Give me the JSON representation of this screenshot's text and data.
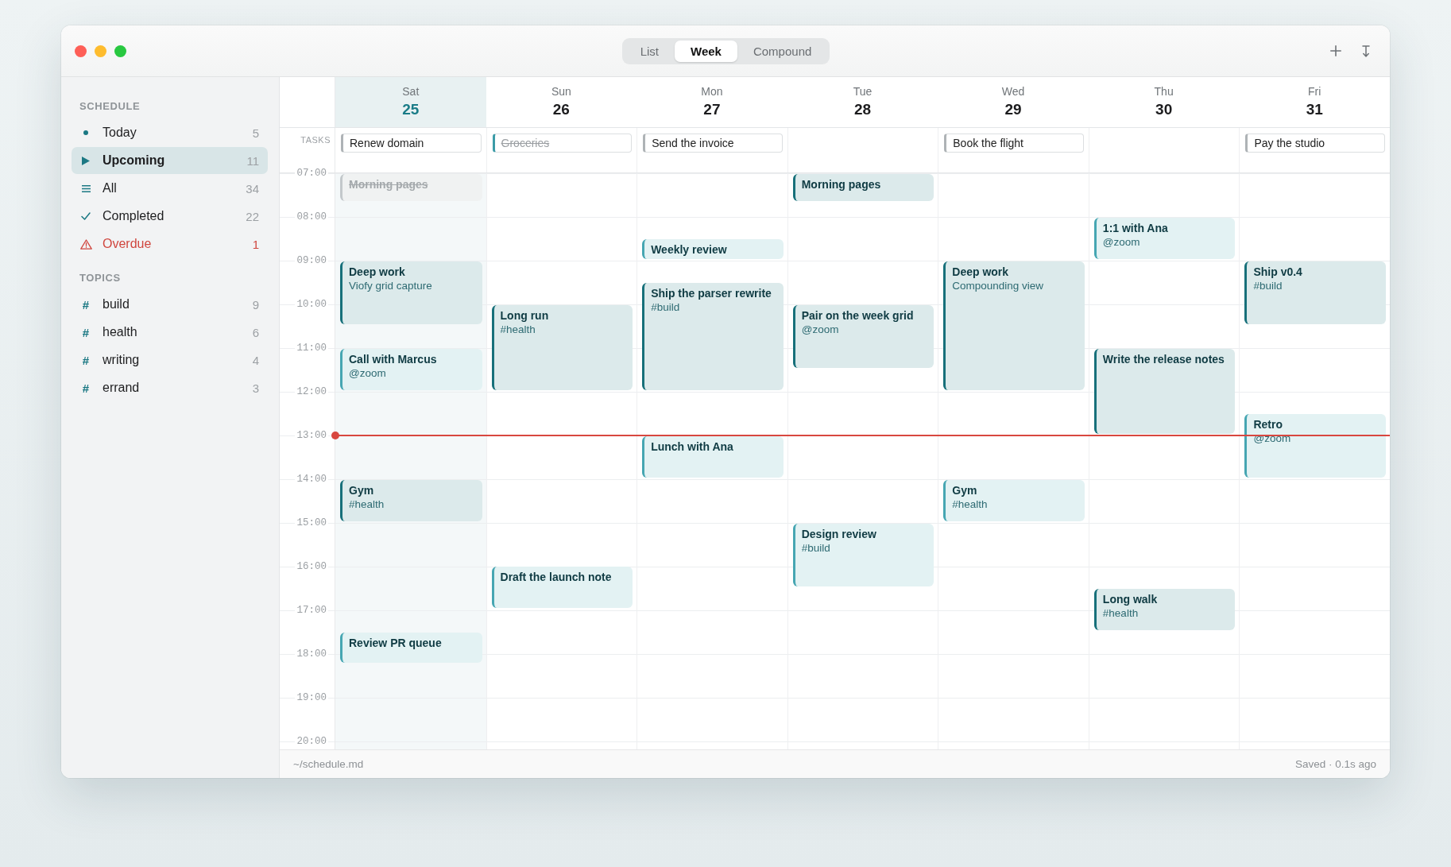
{
  "toolbar": {
    "tabs": [
      {
        "label": "List",
        "selected": false
      },
      {
        "label": "Week",
        "selected": true
      },
      {
        "label": "Compound",
        "selected": false
      }
    ]
  },
  "sidebar": {
    "sections": [
      {
        "heading": "SCHEDULE",
        "items": [
          {
            "kind": "today",
            "label": "Today",
            "count": "5",
            "selected": false
          },
          {
            "kind": "upcoming",
            "label": "Upcoming",
            "count": "11",
            "selected": true
          },
          {
            "kind": "all",
            "label": "All",
            "count": "34",
            "selected": false
          },
          {
            "kind": "completed",
            "label": "Completed",
            "count": "22",
            "selected": false
          },
          {
            "kind": "overdue",
            "label": "Overdue",
            "count": "1",
            "selected": false
          }
        ]
      },
      {
        "heading": "TOPICS",
        "items": [
          {
            "kind": "topic",
            "symbol": "#",
            "label": "build",
            "count": "9",
            "selected": false
          },
          {
            "kind": "topic",
            "symbol": "#",
            "label": "health",
            "count": "6",
            "selected": false
          },
          {
            "kind": "topic",
            "symbol": "#",
            "label": "writing",
            "count": "4",
            "selected": false
          },
          {
            "kind": "topic",
            "symbol": "#",
            "label": "errand",
            "count": "3",
            "selected": false
          }
        ]
      }
    ]
  },
  "calendar": {
    "tasks_label": "TASKS",
    "hours": [
      "07:00",
      "08:00",
      "09:00",
      "10:00",
      "11:00",
      "12:00",
      "13:00",
      "14:00",
      "15:00",
      "16:00",
      "17:00",
      "18:00",
      "19:00",
      "20:00"
    ],
    "days": [
      {
        "name": "Sat",
        "number": "25",
        "today": true,
        "tasks": [
          {
            "title": "Renew domain",
            "done": false
          }
        ],
        "events": [
          {
            "title": "Morning pages",
            "done": true,
            "color": "#c3c8cb"
          },
          {
            "title": "Deep work",
            "note": "Viofy grid capture",
            "done": false,
            "color": "#17707a"
          },
          {
            "title": "Call with Marcus",
            "note": "@zoom",
            "done": false,
            "color": "#46a6b2"
          },
          {
            "title": "Gym",
            "note": "#health",
            "done": false,
            "color": "#17707a"
          },
          {
            "title": "Review PR queue",
            "done": false,
            "color": "#46a6b2"
          }
        ]
      },
      {
        "name": "Sun",
        "number": "26",
        "today": false,
        "tasks": [
          {
            "title": "Groceries",
            "done": true
          }
        ],
        "events": [
          {
            "title": "Long run",
            "note": "#health",
            "done": false,
            "color": "#17707a"
          },
          {
            "title": "Draft the launch note",
            "done": false,
            "color": "#46a6b2"
          }
        ]
      },
      {
        "name": "Mon",
        "number": "27",
        "today": false,
        "tasks": [
          {
            "title": "Send the invoice",
            "done": false
          }
        ],
        "events": [
          {
            "title": "Weekly review",
            "done": false,
            "color": "#46a6b2"
          },
          {
            "title": "Ship the parser rewrite",
            "note": "#build",
            "done": false,
            "color": "#17707a"
          },
          {
            "title": "Lunch with Ana",
            "done": false,
            "color": "#46a6b2"
          }
        ]
      },
      {
        "name": "Tue",
        "number": "28",
        "today": false,
        "events": [
          {
            "title": "Morning pages",
            "done": false,
            "color": "#17707a"
          },
          {
            "title": "Pair on the week grid",
            "note": "@zoom",
            "done": false,
            "color": "#17707a"
          },
          {
            "title": "Design review",
            "note": "#build",
            "done": false,
            "color": "#46a6b2"
          }
        ]
      },
      {
        "name": "Wed",
        "number": "29",
        "today": false,
        "tasks": [
          {
            "title": "Book the flight",
            "done": false
          }
        ],
        "events": [
          {
            "title": "Deep work",
            "note": "Compounding view",
            "done": false,
            "color": "#17707a"
          },
          {
            "title": "Gym",
            "note": "#health",
            "done": false,
            "color": "#46a6b2"
          }
        ]
      },
      {
        "name": "Thu",
        "number": "30",
        "today": false,
        "events": [
          {
            "title": "1:1 with Ana",
            "note": "@zoom",
            "done": false,
            "color": "#46a6b2"
          },
          {
            "title": "Write the release notes",
            "done": false,
            "color": "#17707a"
          },
          {
            "title": "Long walk",
            "note": "#health",
            "done": false,
            "color": "#17707a"
          }
        ]
      },
      {
        "name": "Fri",
        "number": "31",
        "today": false,
        "tasks": [
          {
            "title": "Pay the studio",
            "done": false
          }
        ],
        "events": [
          {
            "title": "Ship v0.4",
            "note": "#build",
            "done": false,
            "color": "#17707a"
          },
          {
            "title": "Retro",
            "note": "@zoom",
            "done": false,
            "color": "#46a6b2"
          }
        ]
      }
    ]
  },
  "status_bar": {
    "path": "~/schedule.md",
    "status": "Saved · 0.1s ago"
  }
}
